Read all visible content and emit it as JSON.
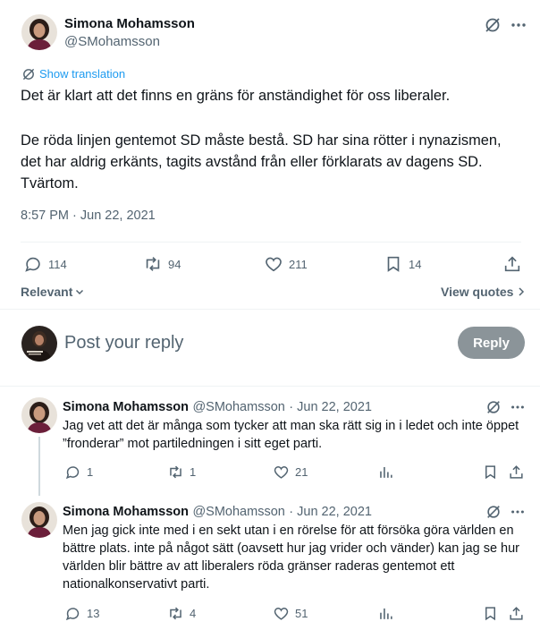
{
  "tweet": {
    "author_name": "Simona Mohamsson",
    "author_handle": "@SMohamsson",
    "show_translation": "Show translation",
    "paragraph1": "Det är klart att det finns en gräns för anständighet för oss liberaler.",
    "paragraph2": "De röda linjen gentemot SD måste bestå. SD har sina rötter i nynazismen, det har aldrig erkänts, tagits avstånd från eller förklarats av dagens SD. Tvärtom.",
    "timestamp": "8:57 PM · Jun 22, 2021",
    "stats": {
      "replies": "114",
      "retweets": "94",
      "likes": "211",
      "bookmarks": "14"
    },
    "sort_label": "Relevant",
    "view_quotes": "View quotes"
  },
  "composer": {
    "placeholder": "Post your reply",
    "button": "Reply"
  },
  "replies": [
    {
      "name": "Simona Mohamsson",
      "handle": "@SMohamsson",
      "date": "· Jun 22, 2021",
      "text": "Jag vet att det är många som tycker att man ska rätt sig in i ledet och inte öppet ”fronderar” mot partiledningen i sitt eget parti.",
      "replies": "1",
      "retweets": "1",
      "likes": "21"
    },
    {
      "name": "Simona Mohamsson",
      "handle": "@SMohamsson",
      "date": "· Jun 22, 2021",
      "text": "Men jag gick inte med i en sekt utan i en rörelse för att försöka göra världen en bättre plats. inte på något sätt (oavsett hur jag vrider och vänder) kan jag se hur världen blir bättre av att liberalers röda gränser raderas gentemot ett nationalkonservativt parti.",
      "replies": "13",
      "retweets": "4",
      "likes": "51"
    }
  ],
  "colors": {
    "accent": "#1d9bf0",
    "muted": "#536471",
    "reply_button": "#8b9499",
    "divider": "#eff3f4"
  }
}
